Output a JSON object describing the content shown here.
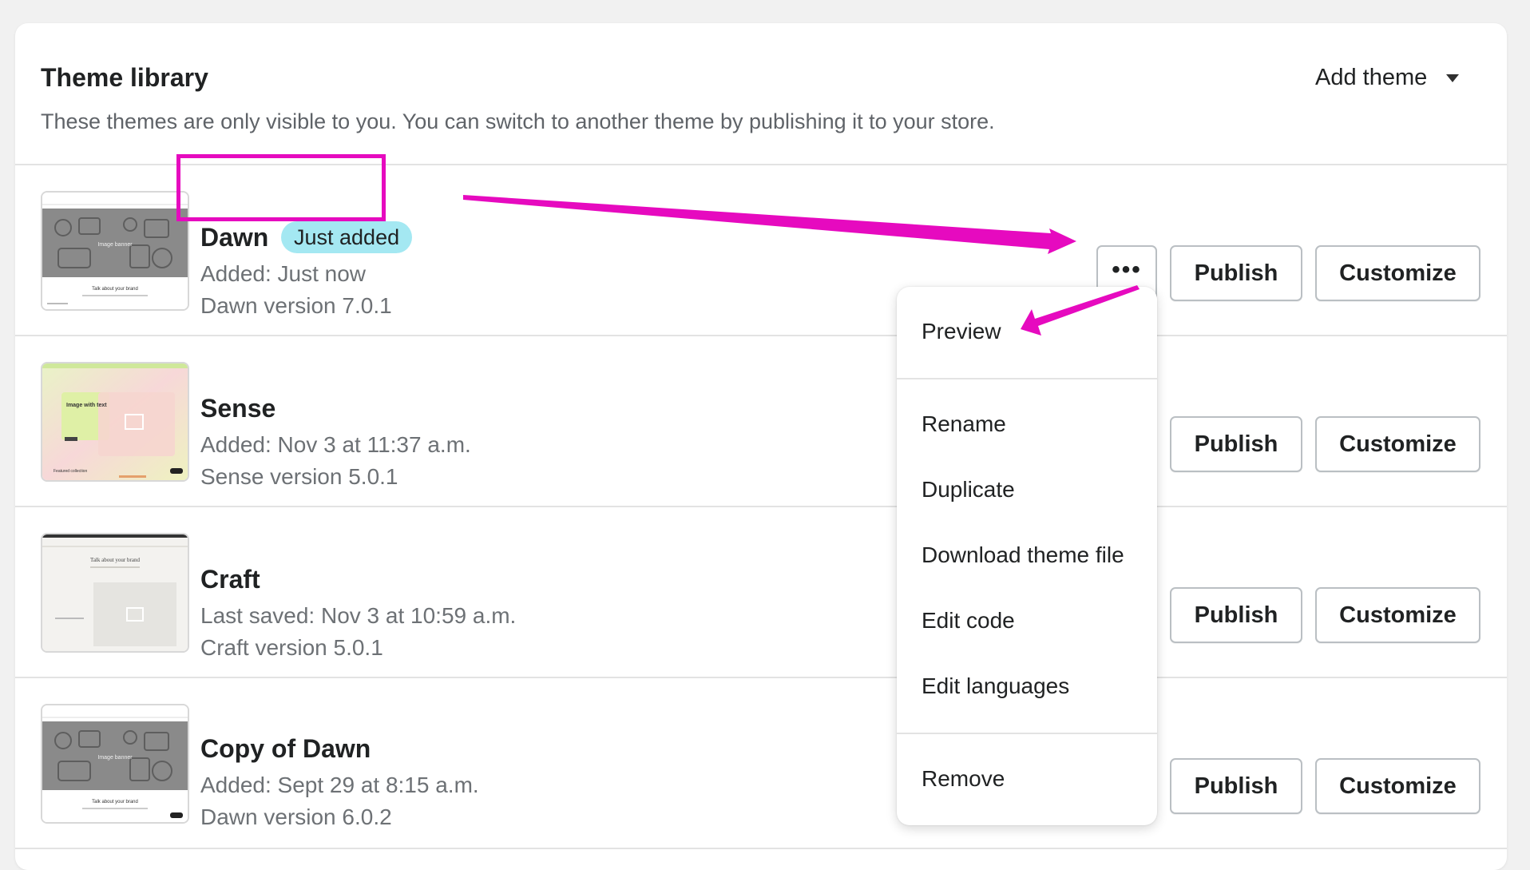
{
  "header": {
    "title": "Theme library",
    "subtitle": "These themes are only visible to you. You can switch to another theme by publishing it to your store.",
    "add_theme_label": "Add theme",
    "add_theme_icon": "caret-down-icon"
  },
  "themes": [
    {
      "name": "Dawn",
      "badge": "Just added",
      "line1": "Added: Just now",
      "line2": "Dawn version 7.0.1"
    },
    {
      "name": "Sense",
      "line1": "Added: Nov 3 at 11:37 a.m.",
      "line2": "Sense version 5.0.1"
    },
    {
      "name": "Craft",
      "line1": "Last saved: Nov 3 at 10:59 a.m.",
      "line2": "Craft version 5.0.1"
    },
    {
      "name": "Copy of Dawn",
      "line1": "Added: Sept 29 at 8:15 a.m.",
      "line2": "Dawn version 6.0.2"
    }
  ],
  "buttons": {
    "more_label": "•••",
    "publish_label": "Publish",
    "customize_label": "Customize"
  },
  "menu": {
    "items": [
      "Preview",
      "Rename",
      "Duplicate",
      "Download theme file",
      "Edit code",
      "Edit languages",
      "Remove"
    ]
  },
  "thumbnails": {
    "dawn": {
      "banner_text": "Image banner",
      "footer_text": "Talk about your brand"
    },
    "sense": {
      "heading_text": "Image with text",
      "footer_text": "Featured collection"
    },
    "craft": {
      "heading_text": "Talk about your brand"
    }
  },
  "colors": {
    "annotation": "#e60abf",
    "badge_bg": "#a4e8f2"
  }
}
